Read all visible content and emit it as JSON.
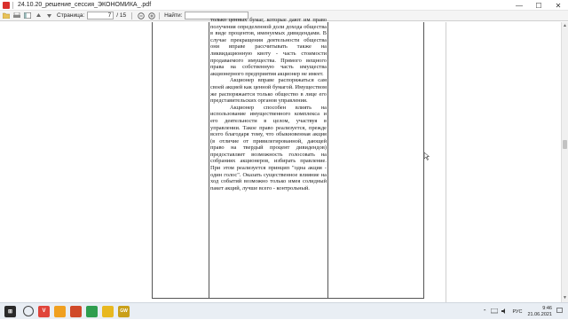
{
  "window": {
    "title": "24.10.20_решение_сессия_ЭКОНОМИКА_.pdf",
    "controls": {
      "minimize": "—",
      "maximize": "☐",
      "close": "✕"
    }
  },
  "toolbar": {
    "page_label": "Страница:",
    "current_page": "7",
    "total_pages": "/ 15",
    "find_label": "Найти:",
    "find_value": ""
  },
  "document": {
    "paragraphs": [
      "только ценных бумаг, которые дают им право получения определенной доли дохода общества в виде процентов, именуемых дивидендами. В случае прекращения деятельности общества они вправе рассчитывать также на ликвидационную квоту - часть стоимости продаваемого имущества. Прямого вещного права на собственную часть имущества акционерного предприятия акционер не имеет.",
      "Акционер вправе распоряжаться сам своей акцией как ценной бумагой. Имуществом же распоряжается только общество в лице его представительских органов управления.",
      "Акционер способен влиять на использование имущественного комплекса и его деятельности в целом, участвуя в управлении. Такое право реализуется, прежде всего благодаря тому, что обыкновенная акция (в отличие от привилегированной, дающей право на твердый процент дивидендов) предоставляет возможность голосовать на собраниях акционеров, избирать правление. При этом реализуется принцип \"одна акция - один голос\". Оказать существенное влияние на ход событий возможно только имея солидный пакет акций, лучше всего - контрольный."
    ]
  },
  "taskbar": {
    "items": [
      {
        "name": "start",
        "color": "#2a2a2a",
        "glyph": "⊞"
      },
      {
        "name": "vivaldi",
        "color": "#e0443a",
        "glyph": "V"
      },
      {
        "name": "app-orange",
        "color": "#f0a020",
        "glyph": ""
      },
      {
        "name": "app-flag",
        "color": "#d04a2a",
        "glyph": ""
      },
      {
        "name": "app-green",
        "color": "#2f9e4f",
        "glyph": ""
      },
      {
        "name": "app-yellow",
        "color": "#e8b820",
        "glyph": ""
      },
      {
        "name": "app-gw",
        "color": "#c9a01a",
        "glyph": "GW"
      }
    ],
    "language": "РУС",
    "time": "9:46",
    "date": "21.06.2021"
  }
}
